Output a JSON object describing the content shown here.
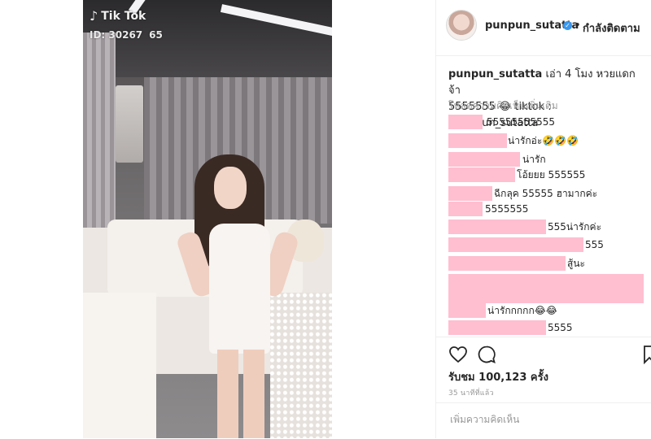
{
  "video": {
    "tiktok_label": "Tik Tok",
    "tiktok_id": "ID: 30267    65"
  },
  "header": {
    "username": "punpun_sutatta",
    "separator": "•",
    "follow_status": "กำลังติดตาม",
    "verified_icon": "verified-badge-icon"
  },
  "caption": {
    "username": "punpun_sutatta",
    "line1": "เอ่า 4 โมง หวยแดกจ้า",
    "line2": "5555555 😂 tiktok : ppunpun_sutatta"
  },
  "load_more": "โหลดความคิดเห็นเพิ่มเติม",
  "comments": [
    {
      "text": "55555555555"
    },
    {
      "text": "น่ารักอ่ะ🤣🤣🤣"
    },
    {
      "text": "น่ารัก"
    },
    {
      "text": "โอ้ยยย 555555"
    },
    {
      "text": "ฉีกลุค 55555 ฮามากค่ะ"
    },
    {
      "text": "5555555"
    },
    {
      "text": "555น่ารักค่ะ"
    },
    {
      "text": "555"
    },
    {
      "text": "สู้นะ"
    },
    {
      "text": "น่ารักกกกก😂😂"
    },
    {
      "text": "5555"
    }
  ],
  "stats": {
    "views": "รับชม 100,123 ครั้ง",
    "time_ago": "35 นาทีที่แล้ว"
  },
  "add_comment": {
    "placeholder": "เพิ่มความคิดเห็น"
  },
  "colors": {
    "redaction": "#ffbfd0",
    "verified": "#3897f0",
    "muted_text": "#999999"
  }
}
